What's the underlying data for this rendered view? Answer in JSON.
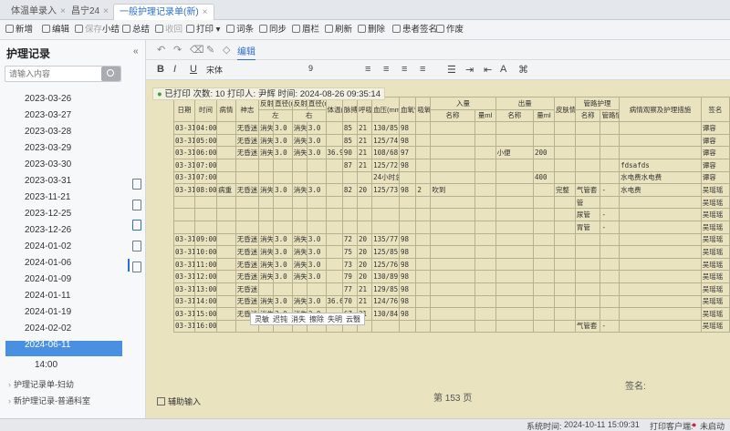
{
  "tabs": [
    {
      "label": "体温单录入",
      "close": "×"
    },
    {
      "label": "昌宁24",
      "close": "×"
    },
    {
      "label": "一般护理记录单(新)",
      "close": "×"
    }
  ],
  "toolbar": {
    "new": "新增",
    "edit": "编辑",
    "save": "保存",
    "summary": "小结",
    "total": "总结",
    "recall": "收回",
    "print": "打印",
    "words": "词条",
    "sync": "同步",
    "eyebrow": "眉栏",
    "refresh": "刷新",
    "delete": "删除",
    "patient_sign": "患者签名",
    "void": "作废"
  },
  "sidebar": {
    "title": "护理记录",
    "collapse": "«",
    "search_placeholder": "请输入内容",
    "dates": [
      "2023-03-26",
      "2023-03-27",
      "2023-03-28",
      "2023-03-29",
      "2023-03-30",
      "2023-03-31",
      "2023-11-21",
      "2023-12-25",
      "2023-12-26",
      "2024-01-02",
      "2024-01-06",
      "2024-01-09",
      "2024-01-11",
      "2024-01-19",
      "2024-02-02",
      "2024-06-11"
    ],
    "selected_sub": "14:00",
    "tree": [
      {
        "arrow": "›",
        "label": "护理记录单-妇幼"
      },
      {
        "arrow": "›",
        "label": "新护理记录-普通科室"
      }
    ]
  },
  "editor": {
    "tab": "编辑",
    "font": "宋体",
    "size": "9",
    "print_status": "已打印",
    "print_count_label": "次数:",
    "print_count": "10",
    "printer_label": "打印人:",
    "printer": "尹辉",
    "print_time_label": "时间:",
    "print_time": "2024-08-26 09:35:14"
  },
  "sheet": {
    "headers": {
      "date": "日期",
      "time": "时间",
      "condition": "病情",
      "consciousness": "神志",
      "pupil_reflex": "反射",
      "pupil_size": "直径(mm)",
      "temp": "体温(℃)",
      "pulse": "脉搏(次/min)",
      "resp": "呼吸(次/min)",
      "bp": "血压(mmHg)",
      "spo2": "血氧饱和度(%)",
      "oxygen": "吸氧(L/min)",
      "intake": "入量",
      "output": "出量",
      "name": "名称",
      "amount": "量ml",
      "skin": "皮肤情况",
      "pipe": "管路护理",
      "pipe_name": "名称",
      "pipe_state": "管路情况",
      "obs": "病情观察及护理措施",
      "signature": "签名"
    },
    "rows": [
      [
        "03-31",
        "04:00",
        "",
        "无昏迷",
        "消失",
        "3.0",
        "消失",
        "3.0",
        "",
        "85",
        "21",
        "130/85",
        "98",
        "",
        "",
        "",
        "",
        "",
        "",
        "",
        "",
        "",
        "谭容"
      ],
      [
        "03-31",
        "05:00",
        "",
        "无昏迷",
        "消失",
        "3.0",
        "消失",
        "3.0",
        "",
        "85",
        "21",
        "125/74",
        "98",
        "",
        "",
        "",
        "",
        "",
        "",
        "",
        "",
        "",
        "谭容"
      ],
      [
        "03-31",
        "06:00",
        "",
        "无昏迷",
        "消失",
        "3.0",
        "消失",
        "3.0",
        "36.9",
        "90",
        "21",
        "108/68",
        "97",
        "",
        "",
        "",
        "小便",
        "200",
        "",
        "",
        "",
        "",
        "谭容"
      ],
      [
        "03-31",
        "07:00",
        "",
        "",
        "",
        "",
        "",
        "",
        "",
        "87",
        "21",
        "125/72",
        "98",
        "",
        "",
        "",
        "",
        "",
        "",
        "",
        "",
        "fdsafds",
        "谭容"
      ],
      [
        "03-31",
        "07:00",
        "",
        "",
        "",
        "",
        "",
        "",
        "",
        "",
        "",
        "24小时总结",
        "",
        "",
        "",
        "",
        "",
        "400",
        "",
        "",
        "",
        "水电费水电费",
        "谭容"
      ],
      [
        "03-31",
        "08:00",
        "病重",
        "无昏迷",
        "消失",
        "3.0",
        "消失",
        "3.0",
        "",
        "82",
        "20",
        "125/73",
        "98",
        "2",
        "吹到",
        "",
        "",
        "",
        "完整",
        "气管套",
        "-",
        "水电费",
        "吴瑶瑶"
      ],
      [
        "",
        "",
        "",
        "",
        "",
        "",
        "",
        "",
        "",
        "",
        "",
        "",
        "",
        "",
        "",
        "",
        "",
        "",
        "",
        "管",
        "",
        "",
        "吴瑶瑶"
      ],
      [
        "",
        "",
        "",
        "",
        "",
        "",
        "",
        "",
        "",
        "",
        "",
        "",
        "",
        "",
        "",
        "",
        "",
        "",
        "",
        "尿管",
        "-",
        "",
        "吴瑶瑶"
      ],
      [
        "",
        "",
        "",
        "",
        "",
        "",
        "",
        "",
        "",
        "",
        "",
        "",
        "",
        "",
        "",
        "",
        "",
        "",
        "",
        "胃管",
        "-",
        "",
        "吴瑶瑶"
      ],
      [
        "03-31",
        "09:00",
        "",
        "无昏迷",
        "消失",
        "3.0",
        "消失",
        "3.0",
        "",
        "72",
        "20",
        "135/77",
        "98",
        "",
        "",
        "",
        "",
        "",
        "",
        "",
        "",
        "",
        "吴瑶瑶"
      ],
      [
        "03-31",
        "10:00",
        "",
        "无昏迷",
        "消失",
        "3.0",
        "消失",
        "3.0",
        "",
        "75",
        "20",
        "125/85",
        "98",
        "",
        "",
        "",
        "",
        "",
        "",
        "",
        "",
        "",
        "吴瑶瑶"
      ],
      [
        "03-31",
        "11:00",
        "",
        "无昏迷",
        "消失",
        "3.0",
        "消失",
        "3.0",
        "",
        "73",
        "20",
        "125/76",
        "98",
        "",
        "",
        "",
        "",
        "",
        "",
        "",
        "",
        "",
        "吴瑶瑶"
      ],
      [
        "03-31",
        "12:00",
        "",
        "无昏迷",
        "消失",
        "3.0",
        "消失",
        "3.0",
        "",
        "79",
        "20",
        "130/89",
        "98",
        "",
        "",
        "",
        "",
        "",
        "",
        "",
        "",
        "",
        "吴瑶瑶"
      ],
      [
        "03-31",
        "13:00",
        "",
        "无昏迷",
        "",
        "",
        "",
        "",
        "",
        "77",
        "21",
        "129/85",
        "98",
        "",
        "",
        "",
        "",
        "",
        "",
        "",
        "",
        "",
        "吴瑶瑶"
      ],
      [
        "03-31",
        "14:00",
        "",
        "无昏迷",
        "消失",
        "3.0",
        "消失",
        "3.0",
        "36.6",
        "70",
        "21",
        "124/76",
        "98",
        "",
        "",
        "",
        "",
        "",
        "",
        "",
        "",
        "",
        "吴瑶瑶"
      ],
      [
        "03-31",
        "15:00",
        "",
        "无昏迷",
        "消失",
        "3.0",
        "消失",
        "3.0",
        "",
        "67",
        "21",
        "130/84",
        "98",
        "",
        "",
        "",
        "",
        "",
        "",
        "",
        "",
        "",
        "吴瑶瑶"
      ],
      [
        "03-31",
        "16:00",
        "",
        "",
        "",
        "",
        "",
        "",
        "",
        "",
        "",
        "",
        "",
        "",
        "",
        "",
        "",
        "",
        "",
        "气管套",
        "-",
        "",
        "吴瑶瑶"
      ]
    ],
    "context_menu": [
      "灵敏",
      "迟钝",
      "消失",
      "擦除",
      "失明",
      "云翳"
    ],
    "page_label": "第 153 页",
    "sign_label": "签名:"
  },
  "assist": "辅助输入",
  "status": {
    "systime_label": "系统时间:",
    "systime": "2024-10-11 15:09:31",
    "printer_client_label": "打印客户端:",
    "printer_client_state": "未启动"
  },
  "colors": {
    "accent": "#2f6fd0",
    "selected": "#4a90e2",
    "paper": "#e9e3bf",
    "summary_line": "#c0503a"
  }
}
